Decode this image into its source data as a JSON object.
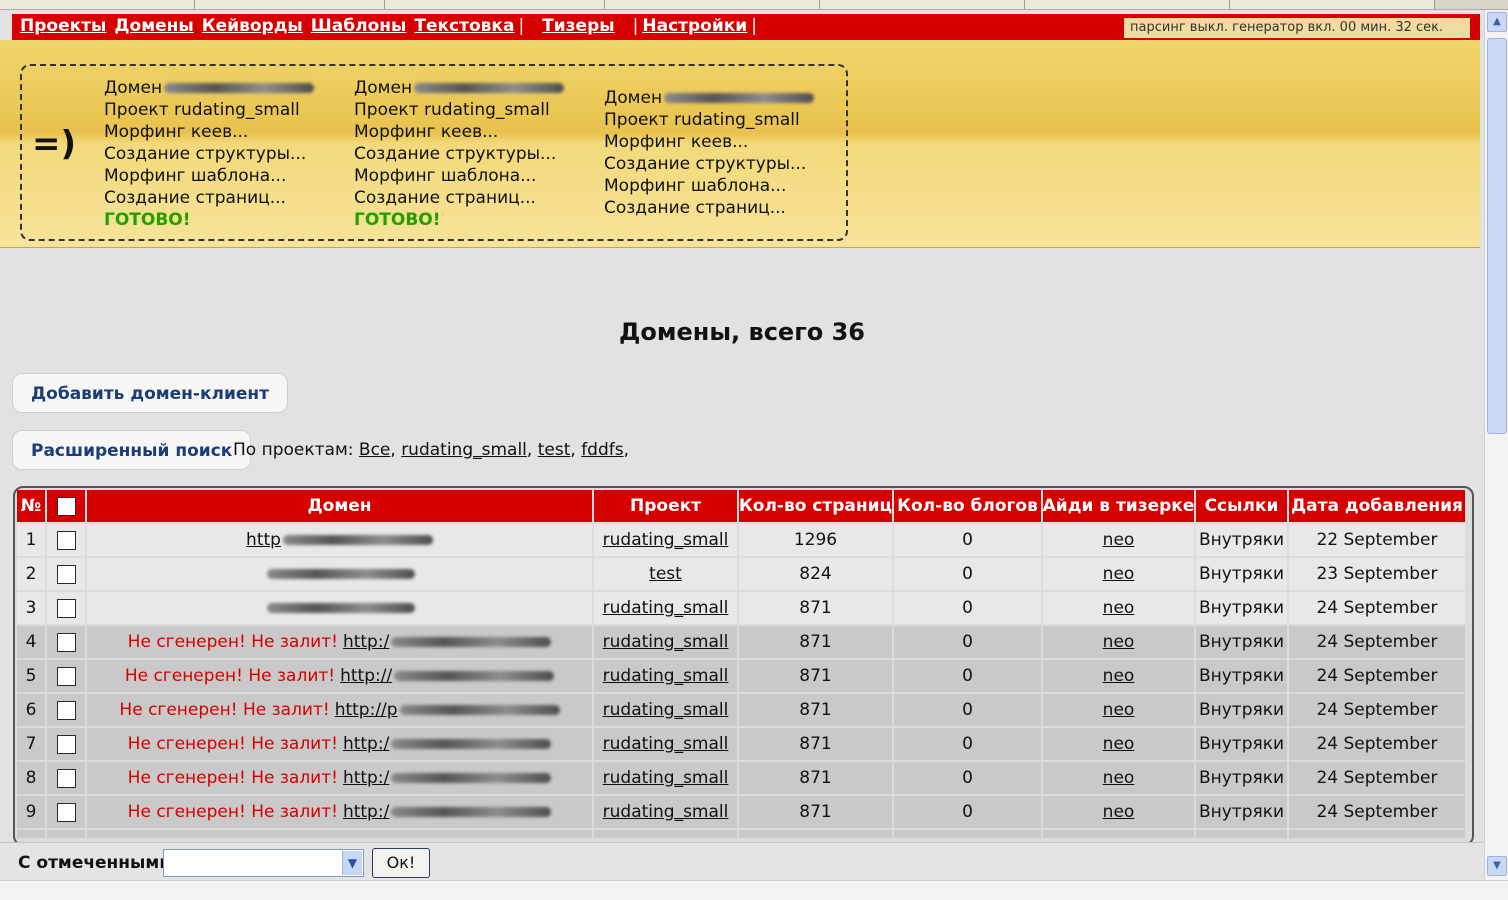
{
  "nav": {
    "items": [
      "Проекты",
      "Домены",
      "Кейворды",
      "Шаблоны",
      "Текстовка"
    ],
    "teasers": "Тизеры",
    "settings": "Настройки",
    "sep": "|"
  },
  "status": "парсинг выкл. генератор вкл. 00 мин. 32 сек.",
  "processes": {
    "smiley": "=)",
    "col1": {
      "domain": "Домен",
      "project": "Проект rudating_small",
      "step1": "Морфинг кеев...",
      "step2": "Создание структуры...",
      "step3": "Морфинг шаблона...",
      "step4": "Создание страниц...",
      "done": "ГОТОВО!"
    },
    "col2": {
      "domain": "Домен",
      "project": "Проект rudating_small",
      "step1": "Морфинг кеев...",
      "step2": "Создание структуры...",
      "step3": "Морфинг шаблона...",
      "step4": "Создание страниц...",
      "done": "ГОТОВО!"
    },
    "col3": {
      "domain": "Домен",
      "project": "Проект rudating_small",
      "step1": "Морфинг кеев...",
      "step2": "Создание структуры...",
      "step3": "Морфинг шаблона...",
      "step4": "Создание страниц..."
    }
  },
  "page_title": "Домены, всего 36",
  "buttons": {
    "add_domain": "Добавить домен-клиент",
    "advanced_search": "Расширенный поиск"
  },
  "filter": {
    "label": "По проектам:",
    "links": [
      "Все",
      "rudating_small",
      "test",
      "fddfs"
    ],
    "sep": ","
  },
  "table": {
    "headers": [
      "№",
      "",
      "Домен",
      "Проект",
      "Кол-во страниц",
      "Кол-во блогов",
      "Айди в тизерке",
      "Ссылки",
      "Дата добавления"
    ],
    "rows": [
      {
        "n": "1",
        "warn": "",
        "domain": "http",
        "project": "rudating_small",
        "pages": "1296",
        "blogs": "0",
        "teaser": "neo",
        "links": "Внутряки",
        "date": "22 September"
      },
      {
        "n": "2",
        "warn": "",
        "domain": "",
        "project": "test",
        "pages": "824",
        "blogs": "0",
        "teaser": "neo",
        "links": "Внутряки",
        "date": "23 September"
      },
      {
        "n": "3",
        "warn": "",
        "domain": "",
        "project": "rudating_small",
        "pages": "871",
        "blogs": "0",
        "teaser": "neo",
        "links": "Внутряки",
        "date": "24 September"
      },
      {
        "n": "4",
        "warn": "Не сгенерен! Не залит!",
        "domain": "http:/",
        "project": "rudating_small",
        "pages": "871",
        "blogs": "0",
        "teaser": "neo",
        "links": "Внутряки",
        "date": "24 September"
      },
      {
        "n": "5",
        "warn": "Не сгенерен! Не залит!",
        "domain": "http://",
        "project": "rudating_small",
        "pages": "871",
        "blogs": "0",
        "teaser": "neo",
        "links": "Внутряки",
        "date": "24 September"
      },
      {
        "n": "6",
        "warn": "Не сгенерен! Не залит!",
        "domain": "http://p",
        "project": "rudating_small",
        "pages": "871",
        "blogs": "0",
        "teaser": "neo",
        "links": "Внутряки",
        "date": "24 September"
      },
      {
        "n": "7",
        "warn": "Не сгенерен! Не залит!",
        "domain": "http:/",
        "project": "rudating_small",
        "pages": "871",
        "blogs": "0",
        "teaser": "neo",
        "links": "Внутряки",
        "date": "24 September"
      },
      {
        "n": "8",
        "warn": "Не сгенерен! Не залит!",
        "domain": "http:/",
        "project": "rudating_small",
        "pages": "871",
        "blogs": "0",
        "teaser": "neo",
        "links": "Внутряки",
        "date": "24 September"
      },
      {
        "n": "9",
        "warn": "Не сгенерен! Не залит!",
        "domain": "http:/",
        "project": "rudating_small",
        "pages": "871",
        "blogs": "0",
        "teaser": "neo",
        "links": "Внутряки",
        "date": "24 September"
      }
    ]
  },
  "footer": {
    "label": "С отмеченными:",
    "select_value": "",
    "ok": "Ок!"
  },
  "colors": {
    "accent_red": "#d60000",
    "panel_yellow": "#e8c24e",
    "done_green": "#22a000",
    "button_text": "#1c3d73"
  }
}
